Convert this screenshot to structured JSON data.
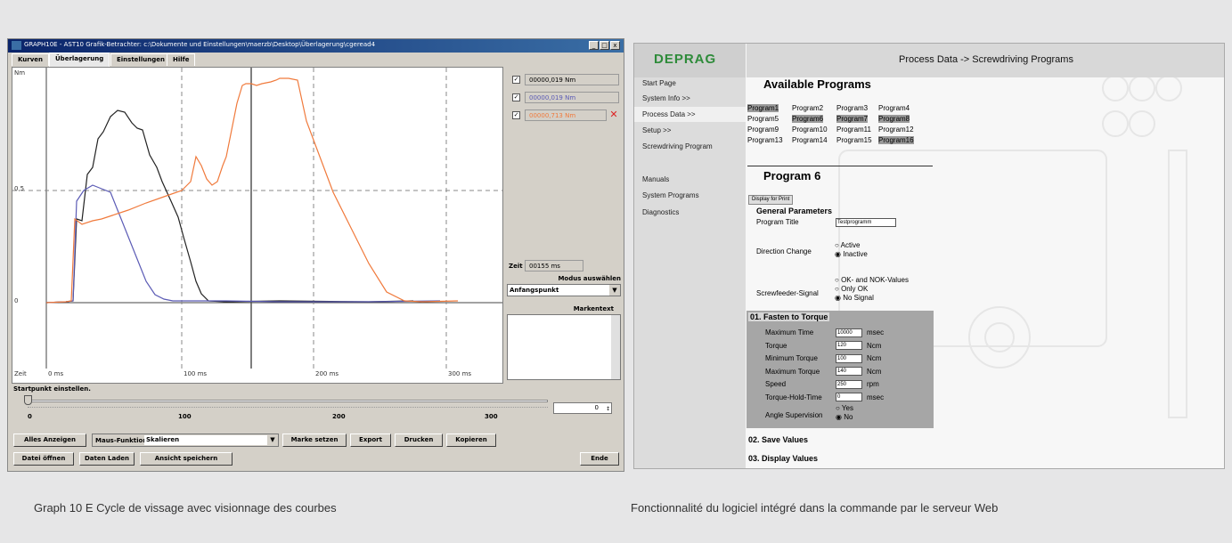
{
  "left_window": {
    "title": "GRAPH10E - AST10 Grafik-Betrachter: c:\\Dokumente und Einstellungen\\maerzb\\Desktop\\Überlagerung\\cgeread4",
    "tabs": [
      "Kurven",
      "Überlagerung",
      "Einstellungen",
      "Hilfe"
    ],
    "plot": {
      "y_unit": "Nm",
      "y_ticks": [
        "0,5",
        "0"
      ],
      "x_start_label": "Zeit",
      "x_ticks": [
        "0 ms",
        "100 ms",
        "200 ms",
        "300 ms"
      ]
    },
    "side": {
      "values": [
        "00000,019 Nm",
        "00000,019 Nm",
        "00000,713 Nm"
      ],
      "zeit_label": "Zeit",
      "zeit_value": "00155 ms",
      "modus_label": "Modus auswählen",
      "modus_value": "Anfangspunkt",
      "markentext_label": "Markentext"
    },
    "startpunkt_label": "Startpunkt einstellen.",
    "slider_ticks": [
      "0",
      "100",
      "200",
      "300"
    ],
    "slider_value": "0",
    "buttons": {
      "alles_anzeigen": "Alles Anzeigen",
      "maus_funktion": "Maus-Funktion:",
      "maus_select": "Skalieren",
      "marke_setzen": "Marke setzen",
      "export": "Export",
      "drucken": "Drucken",
      "kopieren": "Kopieren",
      "datei_oeffnen": "Datei öffnen",
      "daten_laden": "Daten Laden",
      "ansicht_speichern": "Ansicht speichern",
      "ende": "Ende"
    },
    "colors": {
      "black": "#222222",
      "blue": "#5b5bb5",
      "orange": "#f07a3c"
    }
  },
  "right_window": {
    "logo": "DEPRAG",
    "header": "Process Data -> Screwdriving Programs",
    "nav": [
      "Start Page",
      "System Info >>",
      "Process Data >>",
      "Setup >>",
      "Screwdriving Program",
      "Manuals",
      "System Programs",
      "Diagnostics"
    ],
    "available_title": "Available Programs",
    "programs": [
      [
        "Program1",
        "Program2",
        "Program3",
        "Program4"
      ],
      [
        "Program5",
        "Program6",
        "Program7",
        "Program8"
      ],
      [
        "Program9",
        "Program10",
        "Program11",
        "Program12"
      ],
      [
        "Program13",
        "Program14",
        "Program15",
        "Program16"
      ]
    ],
    "program_title": "Program 6",
    "display_print": "Display for Print",
    "general_params": "General Parameters",
    "program_title_label": "Program Title",
    "program_title_value": "Testprogramm",
    "direction_label": "Direction Change",
    "direction_opts": [
      "Active",
      "Inactive"
    ],
    "feeder_label": "Screwfeeder-Signal",
    "feeder_opts": [
      "OK- and NOK-Values",
      "Only OK",
      "No Signal"
    ],
    "step1_title": "01. Fasten to Torque",
    "params": [
      {
        "label": "Maximum Time",
        "value": "10000",
        "unit": "msec"
      },
      {
        "label": "Torque",
        "value": "120",
        "unit": "Ncm"
      },
      {
        "label": "Minimum Torque",
        "value": "100",
        "unit": "Ncm"
      },
      {
        "label": "Maximum Torque",
        "value": "140",
        "unit": "Ncm"
      },
      {
        "label": "Speed",
        "value": "250",
        "unit": "rpm"
      },
      {
        "label": "Torque-Hold-Time",
        "value": "0",
        "unit": "msec"
      }
    ],
    "angle_label": "Angle Supervision",
    "angle_opts": [
      "Yes",
      "No"
    ],
    "step2": "02. Save Values",
    "step3": "03. Display Values"
  },
  "captions": {
    "left": "Graph 10 E  Cycle de vissage avec visionnage des courbes",
    "right": "Fonctionnalité du logiciel intégré dans la commande par le serveur Web"
  }
}
